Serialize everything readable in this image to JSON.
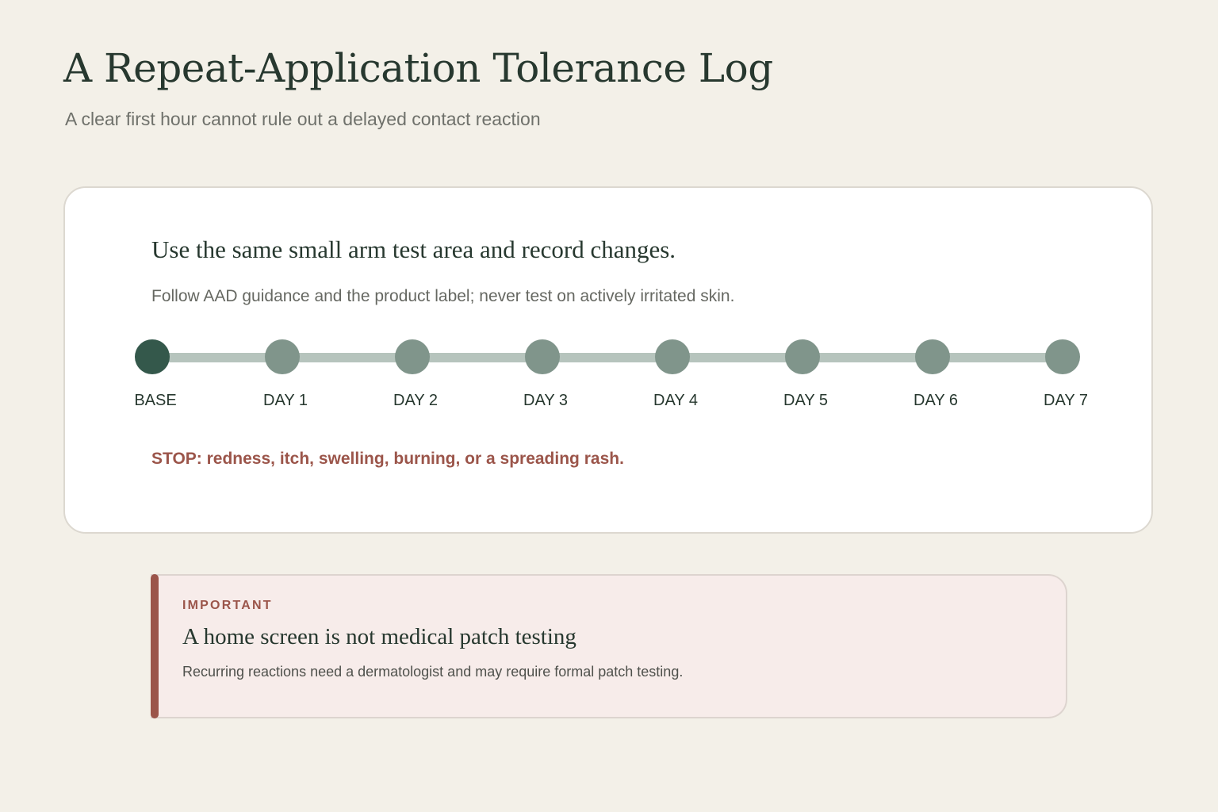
{
  "header": {
    "title": "A Repeat-Application Tolerance Log",
    "subtitle": "A clear first hour cannot rule out a delayed contact reaction"
  },
  "card": {
    "heading": "Use the same small arm test area and record changes.",
    "guidance": "Follow AAD guidance and the product label; never test on actively irritated skin.",
    "timeline": {
      "current_index": 0,
      "steps": [
        {
          "label": "BASE"
        },
        {
          "label": "DAY 1"
        },
        {
          "label": "DAY 2"
        },
        {
          "label": "DAY 3"
        },
        {
          "label": "DAY 4"
        },
        {
          "label": "DAY 5"
        },
        {
          "label": "DAY 6"
        },
        {
          "label": "DAY 7"
        }
      ]
    },
    "stop_warning": "STOP: redness, itch, swelling, burning, or a spreading rash."
  },
  "notice": {
    "eyebrow": "IMPORTANT",
    "heading": "A home screen is not medical patch testing",
    "body": "Recurring reactions need a dermatologist and may require formal patch testing."
  },
  "colors": {
    "background": "#f3f0e8",
    "primary_dark_green": "#27382f",
    "current_step": "#34584b",
    "future_step": "#80958b",
    "timeline_track": "#b6c4bd",
    "warning": "#9b554a",
    "notice_background": "#f7ecea"
  }
}
